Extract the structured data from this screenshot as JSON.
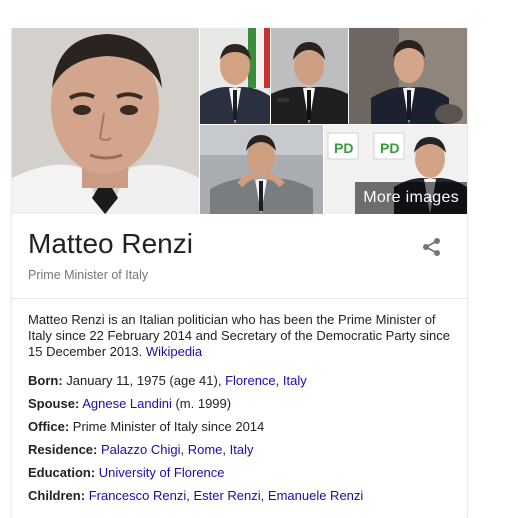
{
  "images": {
    "more_images_label": "More images"
  },
  "entity": {
    "title": "Matteo Renzi",
    "subtitle": "Prime Minister of Italy"
  },
  "description": {
    "text": "Matteo Renzi is an Italian politician who has been the Prime Minister of Italy since 22 February 2014 and Secretary of the Democratic Party since 15 December 2013.",
    "source_link": "Wikipedia"
  },
  "facts": {
    "born": {
      "label": "Born:",
      "text": "January 11, 1975 (age 41),",
      "links": [
        "Florence",
        "Italy"
      ]
    },
    "spouse": {
      "label": "Spouse:",
      "link": "Agnese Landini",
      "suffix": "(m. 1999)"
    },
    "office": {
      "label": "Office:",
      "text": "Prime Minister of Italy since 2014"
    },
    "residence": {
      "label": "Residence:",
      "links": [
        "Palazzo Chigi",
        "Rome",
        "Italy"
      ]
    },
    "education": {
      "label": "Education:",
      "link": "University of Florence"
    },
    "children": {
      "label": "Children:",
      "links": [
        "Francesco Renzi",
        "Ester Renzi",
        "Emanuele Renzi"
      ]
    }
  },
  "icons": {
    "share": "share-icon"
  }
}
